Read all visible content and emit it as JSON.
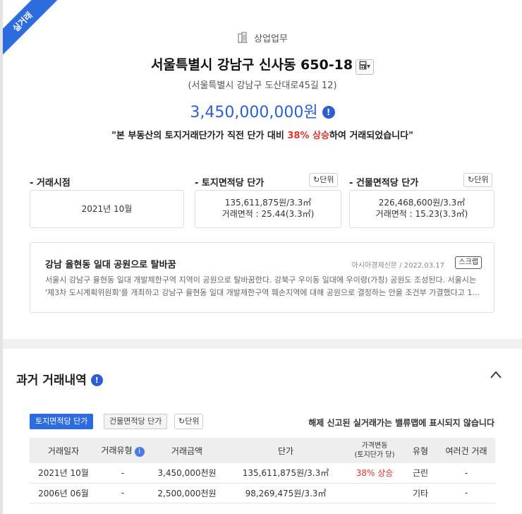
{
  "ribbon": "실거래",
  "header": {
    "category": "상업업무",
    "address": "서울특별시 강남구 신사동 650-18",
    "calc_caret": "▾",
    "road_address": "(서울특별시 강남구 도산대로45길 12)",
    "price": "3,450,000,000원",
    "summary_prefix": "\"본 부동산의 토지거래단가가 직전 단가 대비 ",
    "summary_highlight": "38% 상승",
    "summary_suffix": "하여 거래되었습니다\""
  },
  "metrics": {
    "date_label": "- 거래시점",
    "date_value": "2021년 10월",
    "land_label": "- 토지면적당 단가",
    "land_unit_btn": "단위",
    "land_price": "135,611,875원/3.3㎡",
    "land_area": "거래면적 : 25.44(3.3㎡)",
    "bldg_label": "- 건물면적당 단가",
    "bldg_unit_btn": "단위",
    "bldg_price": "226,468,600원/3.3㎡",
    "bldg_area": "거래면적 : 15.23(3.3㎡)"
  },
  "news": {
    "title": "강남 율현동 일대 공원으로 탈바꿈",
    "source": "아시아경제신문",
    "separator": "/",
    "date": "2022.03.17",
    "scrap": "스크랩",
    "body": "서울시 강남구 율현동 일대 개발제한구역 지역이 공원으로 탈바꿈한다. 강북구 우이동 일대에 우이령(가칭) 공원도 조성된다. 서울시는 '제3차 도시계획위원회'를 개최하고 강남구 율현동 일대 개발제한구역 훼손지역에 대해 공원으로 결정하는 안을 조건부 가결했다고 1…"
  },
  "history": {
    "title": "과거 거래내역",
    "tabs": [
      "토지면적당 단가",
      "건물면적당 단가"
    ],
    "unit_btn": "단위",
    "notice": "해제 신고된 실거래가는 밸류맵에 표시되지 않습니다",
    "headers": [
      "거래일자",
      "거래유형",
      "거래금액",
      "단가",
      "가격변동\n(토지단가 당)",
      "유형",
      "여러건 거래"
    ],
    "rows": [
      [
        "2021년 10월",
        "-",
        "3,450,000천원",
        "135,611,875원/3.3㎡",
        "38% 상승",
        "근린",
        "-"
      ],
      [
        "2006년 06월",
        "-",
        "2,500,000천원",
        "98,269,475원/3.3㎡",
        "",
        "기타",
        "-"
      ]
    ]
  },
  "colors": {
    "accent": "#2d6cdf",
    "price": "#2f5fcf",
    "increase": "#e0362c"
  }
}
